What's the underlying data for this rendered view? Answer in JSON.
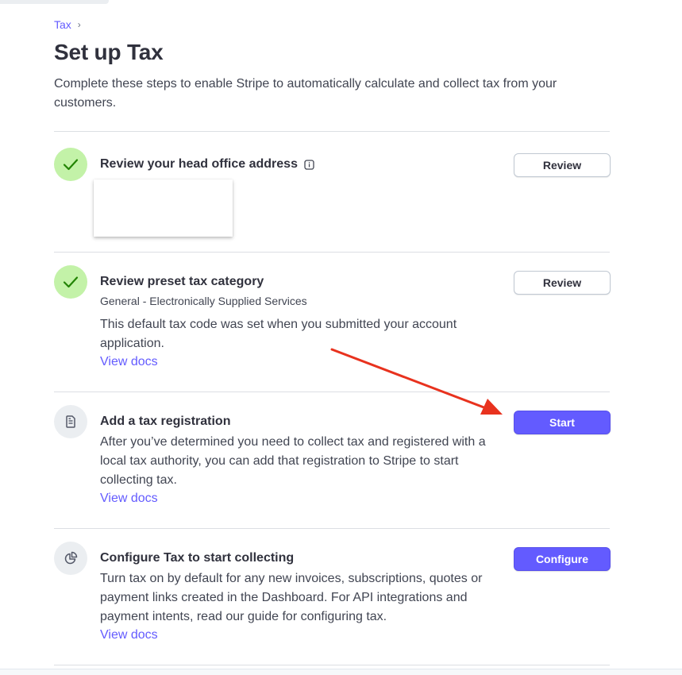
{
  "breadcrumb": {
    "parent": "Tax",
    "separator": "›"
  },
  "page": {
    "title": "Set up Tax",
    "description": "Complete these steps to enable Stripe to automatically calculate and collect tax from your customers."
  },
  "steps": [
    {
      "title": "Review your head office address",
      "status": "complete",
      "icon": "checkmark-icon",
      "info_icon": "info-icon",
      "button": "Review"
    },
    {
      "title": "Review preset tax category",
      "status": "complete",
      "icon": "checkmark-icon",
      "subtitle": "General - Electronically Supplied Services",
      "description": "This default tax code was set when you submitted your account application.",
      "link": "View docs",
      "button": "Review"
    },
    {
      "title": "Add a tax registration",
      "status": "pending",
      "icon": "document-icon",
      "description": "After you’ve determined you need to collect tax and registered with a local tax authority, you can add that registration to Stripe to start collecting tax.",
      "link": "View docs",
      "button": "Start"
    },
    {
      "title": "Configure Tax to start collecting",
      "status": "pending",
      "icon": "pie-chart-icon",
      "description": "Turn tax on by default for any new invoices, subscriptions, quotes or payment links created in the Dashboard. For API integrations and payment intents, read our guide for configuring tax.",
      "link": "View docs",
      "button": "Configure"
    }
  ],
  "colors": {
    "accent": "#635bff",
    "complete_bg": "#c3f2a8",
    "complete_check": "#228403",
    "pending_bg": "#ebeef1",
    "annotation_arrow": "#e8321e"
  }
}
